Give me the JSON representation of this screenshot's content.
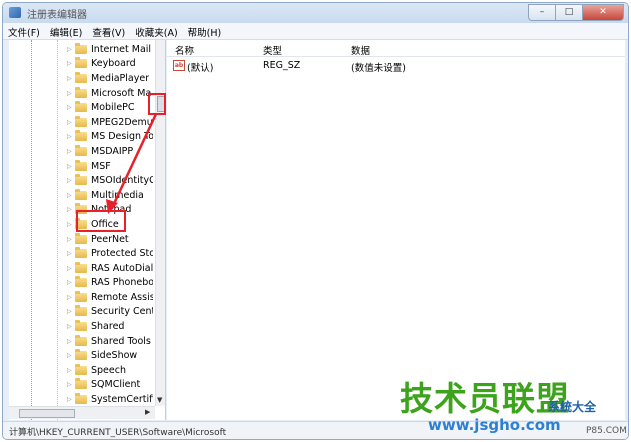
{
  "window": {
    "title": "注册表编辑器",
    "min_glyph": "–",
    "max_glyph": "□",
    "close_glyph": "✕"
  },
  "menu": [
    {
      "label": "文件(F)"
    },
    {
      "label": "编辑(E)"
    },
    {
      "label": "查看(V)"
    },
    {
      "label": "收藏夹(A)"
    },
    {
      "label": "帮助(H)"
    }
  ],
  "tree": {
    "items": [
      {
        "label": "Internet Mail"
      },
      {
        "label": "Keyboard"
      },
      {
        "label": "MediaPlayer"
      },
      {
        "label": "Microsoft Ma"
      },
      {
        "label": "MobilePC"
      },
      {
        "label": "MPEG2Demu"
      },
      {
        "label": "MS Design To"
      },
      {
        "label": "MSDAIPP"
      },
      {
        "label": "MSF"
      },
      {
        "label": "MSOIdentityC"
      },
      {
        "label": "Multimedia"
      },
      {
        "label": "Notepad"
      },
      {
        "label": "Office"
      },
      {
        "label": "PeerNet"
      },
      {
        "label": "Protected Sto"
      },
      {
        "label": "RAS AutoDial"
      },
      {
        "label": "RAS Phonebo"
      },
      {
        "label": "Remote Assis"
      },
      {
        "label": "Security Cent"
      },
      {
        "label": "Shared"
      },
      {
        "label": "Shared Tools"
      },
      {
        "label": "SideShow"
      },
      {
        "label": "Speech"
      },
      {
        "label": "SQMClient"
      },
      {
        "label": "SystemCertific"
      }
    ],
    "selected": "Office"
  },
  "list": {
    "columns": [
      "名称",
      "类型",
      "数据"
    ],
    "rows": [
      {
        "name": "(默认)",
        "type": "REG_SZ",
        "data": "(数值未设置)"
      }
    ]
  },
  "statusbar": {
    "path": "计算机\\HKEY_CURRENT_USER\\Software\\Microsoft"
  },
  "watermark": {
    "title": "技术员联盟",
    "url": "www.jsgho.com",
    "sub": "系统大全",
    "small": "P85.COM"
  },
  "colors": {
    "annotation": "#e8202a",
    "watermark_green": "#3da31c",
    "watermark_blue": "#2c7fd1"
  },
  "icons": {
    "folder": "folder-icon",
    "string_value": "reg-string-icon"
  }
}
